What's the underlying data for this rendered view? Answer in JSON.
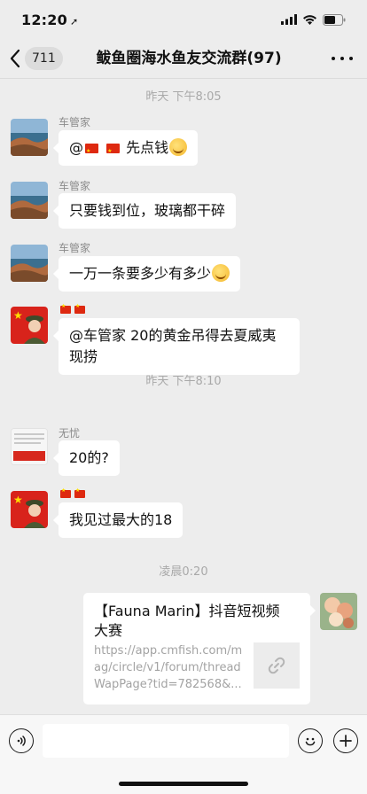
{
  "status_bar": {
    "time": "12:20",
    "location_arrow": "➚"
  },
  "nav": {
    "back_count": "711",
    "title": "鲅鱼圈海水鱼友交流群(97)",
    "muted": true
  },
  "messages": [
    {
      "type": "time",
      "text": "昨天 下午8:05"
    },
    {
      "type": "text",
      "sender": "车管家",
      "text_prefix": "@",
      "text_suffix": " 先点钱",
      "flags": 2,
      "emoji": "face-with-tears-of-joy"
    },
    {
      "type": "text",
      "sender": "车管家",
      "text": "只要钱到位，玻璃都干碎"
    },
    {
      "type": "text",
      "sender": "车管家",
      "text": "一万一条要多少有多少",
      "emoji": "face-with-tears-of-joy"
    },
    {
      "type": "text",
      "sender_flags": 2,
      "lines": [
        "@车管家 20的黄金吊得去夏威夷",
        "现捞"
      ]
    },
    {
      "type": "time",
      "text": "昨天 下午8:10"
    },
    {
      "type": "text",
      "sender": "无忧",
      "text": "20的?"
    },
    {
      "type": "text",
      "sender_flags": 2,
      "text": "我见过最大的18"
    },
    {
      "type": "time",
      "text": "凌晨0:20"
    },
    {
      "type": "link",
      "side": "right",
      "title_lines": [
        "【Fauna Marin】抖音短视频",
        "大赛"
      ],
      "url_lines": [
        "https://app.cmfish.com/m",
        "ag/circle/v1/forum/thread",
        "WapPage?tid=782568&..."
      ]
    }
  ],
  "avatars": {
    "wuyou_text_lines": [
      "中国加油!"
    ]
  },
  "input": {
    "placeholder": "",
    "value": ""
  },
  "colors": {
    "background": "#ededed",
    "bubble": "#ffffff",
    "time_label": "#a9a9a9",
    "flag_red": "#de2910"
  }
}
